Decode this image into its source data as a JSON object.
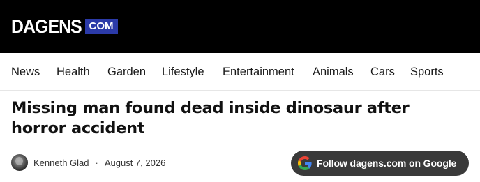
{
  "header": {
    "logo_word": "DAGENS",
    "logo_badge": "COM",
    "logo_badge_color": "#2b3aa8"
  },
  "nav": {
    "items": [
      {
        "label": "News"
      },
      {
        "label": "Health"
      },
      {
        "label": "Garden"
      },
      {
        "label": "Lifestyle"
      },
      {
        "label": "Entertainment"
      },
      {
        "label": "Animals"
      },
      {
        "label": "Cars"
      },
      {
        "label": "Sports"
      }
    ]
  },
  "article": {
    "title": "Missing man found dead inside dinosaur after horror accident",
    "author": "Kenneth Glad",
    "separator": "·",
    "date": "August 7, 2026"
  },
  "follow_button": {
    "label": "Follow dagens.com on Google",
    "icon": "google-g-icon",
    "background": "#3a3a3a"
  }
}
